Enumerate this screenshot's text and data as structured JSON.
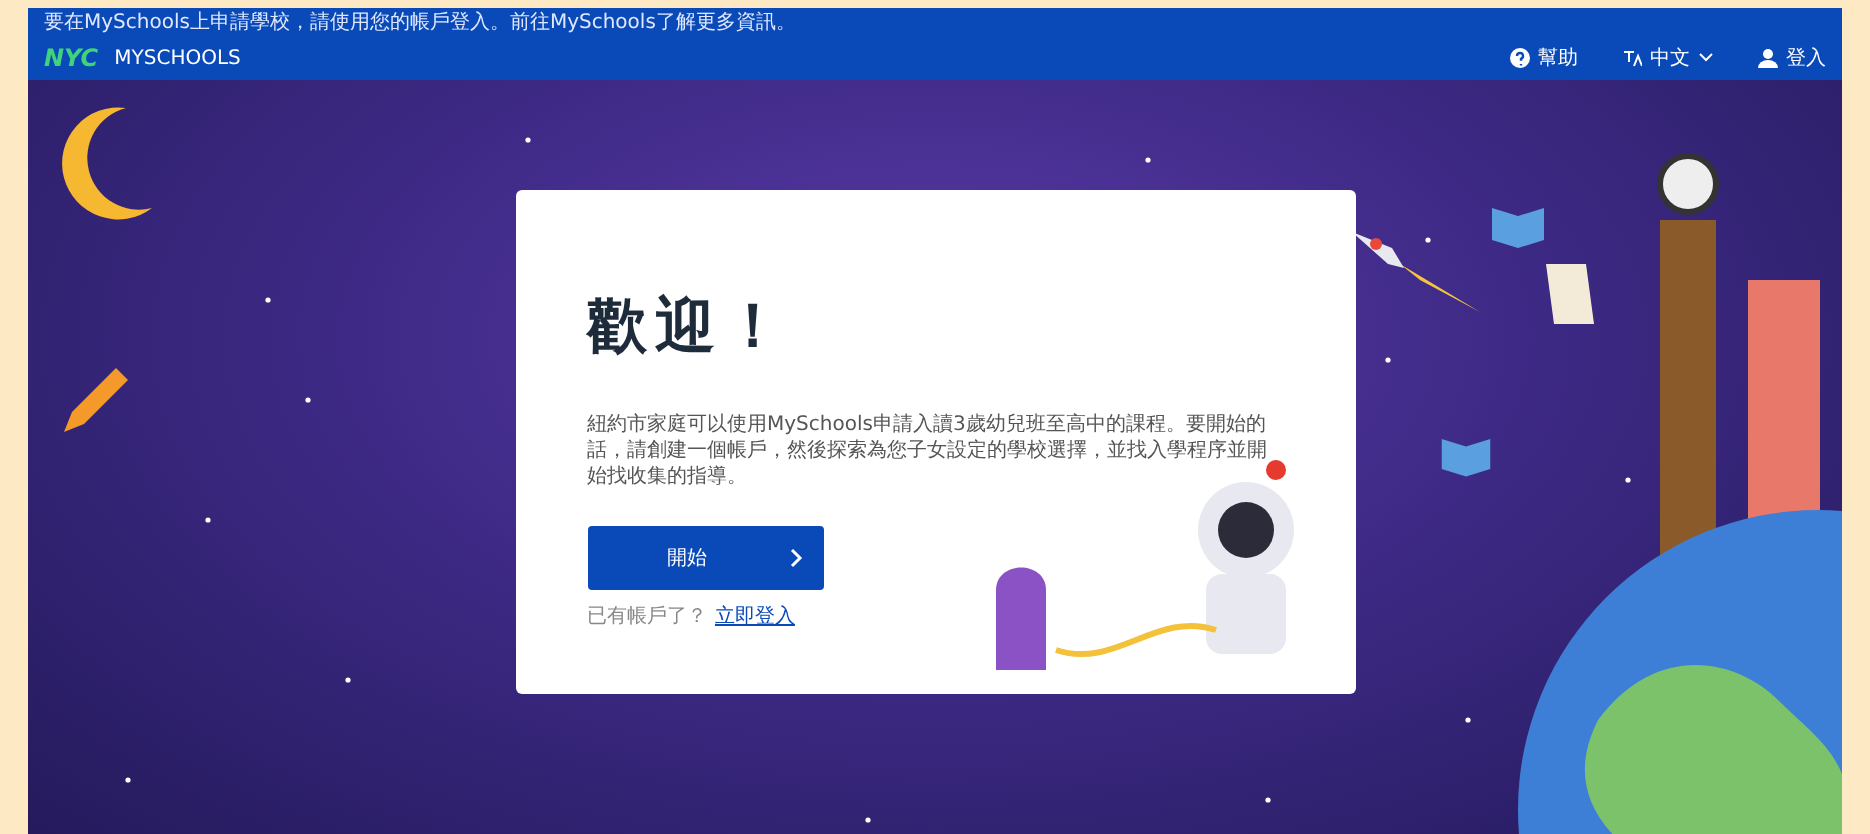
{
  "notice": "要在MySchools上申請學校，請使用您的帳戶登入。前往MySchools了解更多資訊。",
  "header": {
    "logo": "NYC",
    "site_name": "MYSCHOOLS",
    "nav": [
      {
        "kind": "help",
        "label": "幫助"
      },
      {
        "kind": "language",
        "label": "中文"
      },
      {
        "kind": "account",
        "label": "登入"
      }
    ]
  },
  "card": {
    "title": "歡迎！",
    "body": "紐約市家庭可以使用MySchools申請入讀3歲幼兒班至高中的課程。要開始的話，請創建一個帳戶，然後探索為您子女設定的學校選擇，並找入學程序並開始找收集的指導。",
    "button": "開始",
    "signin_prompt": "已有帳戶了？",
    "signin_link": "立即登入"
  }
}
